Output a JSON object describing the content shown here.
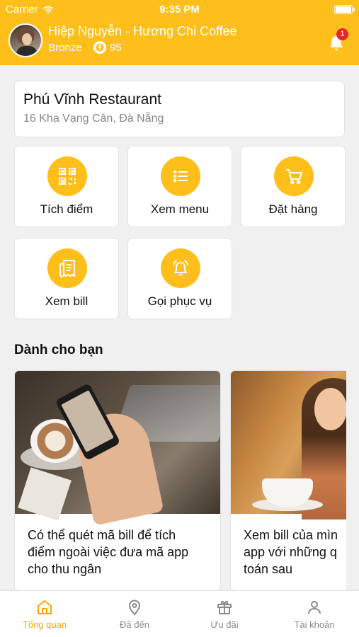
{
  "status_bar": {
    "carrier": "Carrier",
    "time": "9:35 PM"
  },
  "header": {
    "user_name": "Hiệp Nguyễn - Hương Chi Coffee",
    "tier": "Bronze",
    "points": "95",
    "notification_count": "1",
    "brand_color": "#ffbf1a"
  },
  "restaurant": {
    "name": "Phú Vĩnh Restaurant",
    "address": "16 Kha Vạng Cân, Đà Nẵng"
  },
  "actions": [
    {
      "label": "Tích điểm",
      "icon": "qr-code-icon"
    },
    {
      "label": "Xem menu",
      "icon": "menu-list-icon"
    },
    {
      "label": "Đặt hàng",
      "icon": "cart-icon"
    },
    {
      "label": "Xem bill",
      "icon": "bill-icon"
    },
    {
      "label": "Gọi phục vụ",
      "icon": "service-bell-icon"
    }
  ],
  "section": {
    "title": "Dành cho bạn"
  },
  "promos": [
    {
      "lines": [
        "Có thể quét mã bill để tích",
        "điểm ngoài việc đưa mã app",
        "cho thu ngân"
      ]
    },
    {
      "lines": [
        "Xem bill của mìn",
        "app với những q",
        "toán sau"
      ]
    }
  ],
  "tabs": [
    {
      "label": "Tổng quan",
      "icon": "home-icon",
      "active": true
    },
    {
      "label": "Đã đến",
      "icon": "location-pin-icon",
      "active": false
    },
    {
      "label": "Ưu đãi",
      "icon": "gift-icon",
      "active": false
    },
    {
      "label": "Tài khoản",
      "icon": "user-icon",
      "active": false
    }
  ],
  "colors": {
    "active_tab": "#f5a800",
    "inactive_tab": "#8a8a8a",
    "badge": "#e8252c"
  }
}
